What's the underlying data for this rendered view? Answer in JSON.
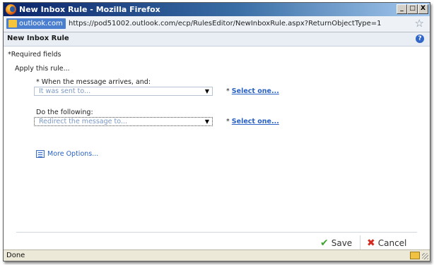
{
  "window": {
    "title": "New Inbox Rule - Mozilla Firefox",
    "min_label": "_",
    "max_label": "□",
    "close_label": "X"
  },
  "address": {
    "site": "outlook.com",
    "url": "https://pod51002.outlook.com/ecp/RulesEditor/NewInboxRule.aspx?ReturnObjectType=1",
    "star": "☆"
  },
  "dialog": {
    "title": "New Inbox Rule",
    "help": "?",
    "required_note": "*Required fields",
    "apply_label": "Apply this rule...",
    "condition_label": "* When the message arrives, and:",
    "condition_value": "It was sent to...",
    "condition_select": "Select one...",
    "action_label": "Do the following:",
    "action_value": "Redirect the message to...",
    "action_select": "Select one...",
    "required_star": "*",
    "more_options": "More Options...",
    "save": "Save",
    "cancel": "Cancel",
    "save_icon": "✔",
    "cancel_icon": "✖"
  },
  "statusbar": {
    "text": "Done"
  },
  "icons": {
    "firefox": "firefox-icon",
    "help": "help-icon",
    "more_options": "list-icon",
    "save": "checkmark-icon",
    "cancel": "x-icon",
    "lock": "lock-icon"
  },
  "colors": {
    "titlebar": "#0a246a",
    "link": "#2a62c4",
    "save_icon": "#3fa52f",
    "cancel_icon": "#d42a1f"
  }
}
